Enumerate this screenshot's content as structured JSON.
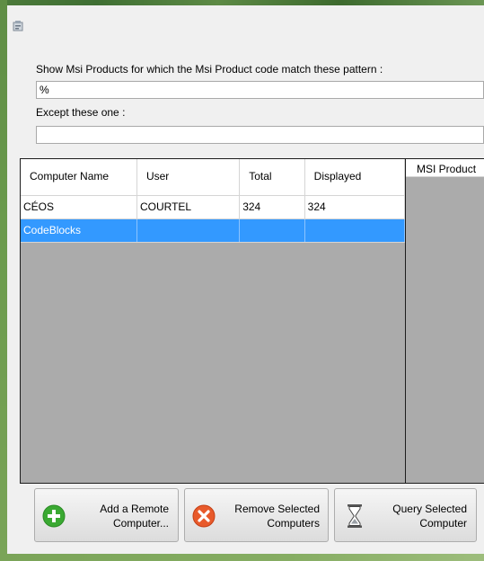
{
  "window": {
    "app_icon": "installer-icon"
  },
  "filter": {
    "pattern_label": "Show Msi Products for which the Msi Product code match these pattern :",
    "pattern_value": "%",
    "except_label": "Except these one :",
    "except_value": ""
  },
  "computers_grid": {
    "columns": [
      "Computer Name",
      "User",
      "Total",
      "Displayed"
    ],
    "rows": [
      {
        "name": "CÉOS",
        "user": "COURTEL",
        "total": "324",
        "displayed": "324",
        "selected": false
      },
      {
        "name": "CodeBlocks",
        "user": "",
        "total": "",
        "displayed": "",
        "selected": true
      }
    ],
    "selection_color": "#3399ff"
  },
  "products_grid": {
    "header": "MSI Product"
  },
  "buttons": {
    "add": {
      "line1": "Add a Remote",
      "line2": "Computer...",
      "icon": "add-icon",
      "color": "#3aa932"
    },
    "remove": {
      "line1": "Remove Selected",
      "line2": "Computers",
      "icon": "remove-icon",
      "color": "#e85a2b"
    },
    "query": {
      "line1": "Query Selected",
      "line2": "Computer",
      "icon": "hourglass-icon"
    }
  }
}
